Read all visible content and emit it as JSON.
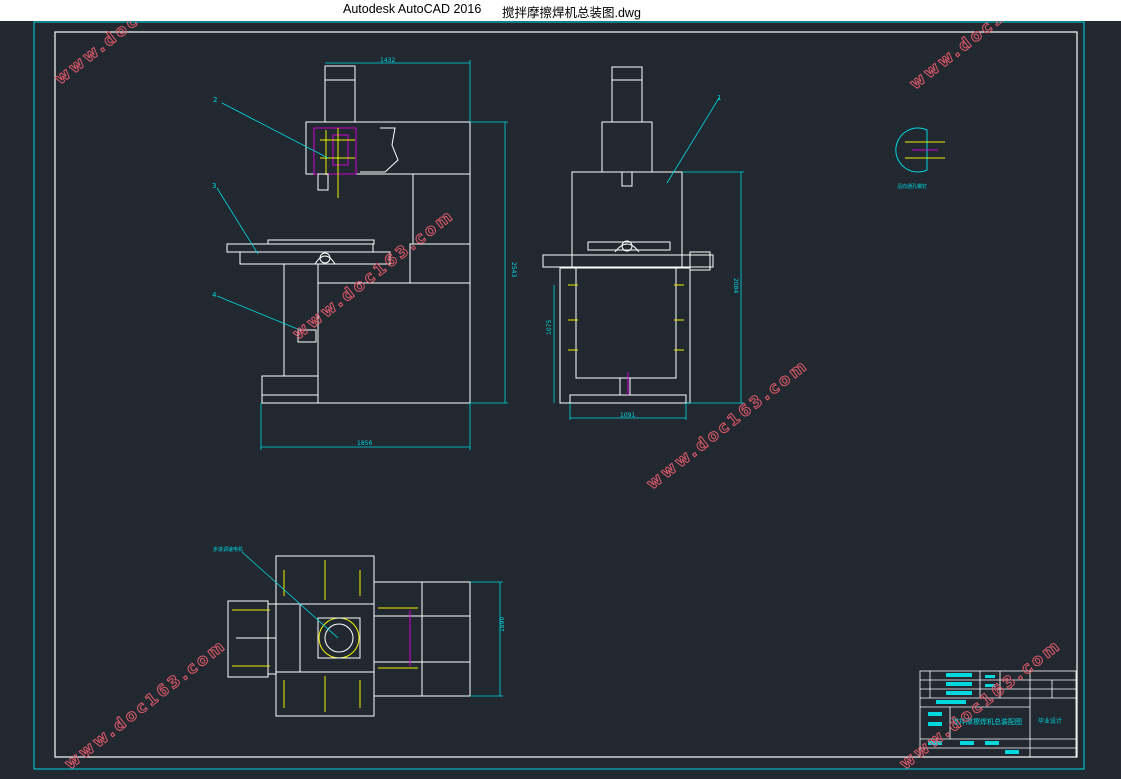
{
  "window": {
    "app_title": "Autodesk AutoCAD 2016",
    "file_name": "搅拌摩擦焊机总装图.dwg"
  },
  "drawing": {
    "dimensions": {
      "front_width_top": "1432",
      "front_height": "2543",
      "front_base_width": "1856",
      "side_height": "2084",
      "side_inner_height": "1075",
      "side_width": "1091",
      "plan_depth": "1890"
    },
    "part_labels": {
      "p1": "1",
      "p2": "2",
      "p3": "3",
      "p4": "4"
    },
    "notes": {
      "detail_caption": "沿向通孔螺钉",
      "plan_callout": "步进调速电机"
    },
    "title_block": {
      "drawing_title": "搅拌摩擦焊机总装配图",
      "design_note": "毕业设计"
    },
    "watermark": "www.doc163.com",
    "colors": {
      "background": "#212830",
      "linework": "#ffffff",
      "cyan": "#00d8e0",
      "yellow": "#f0f000",
      "magenta": "#d000d0",
      "watermark": "#e05a6a"
    }
  }
}
